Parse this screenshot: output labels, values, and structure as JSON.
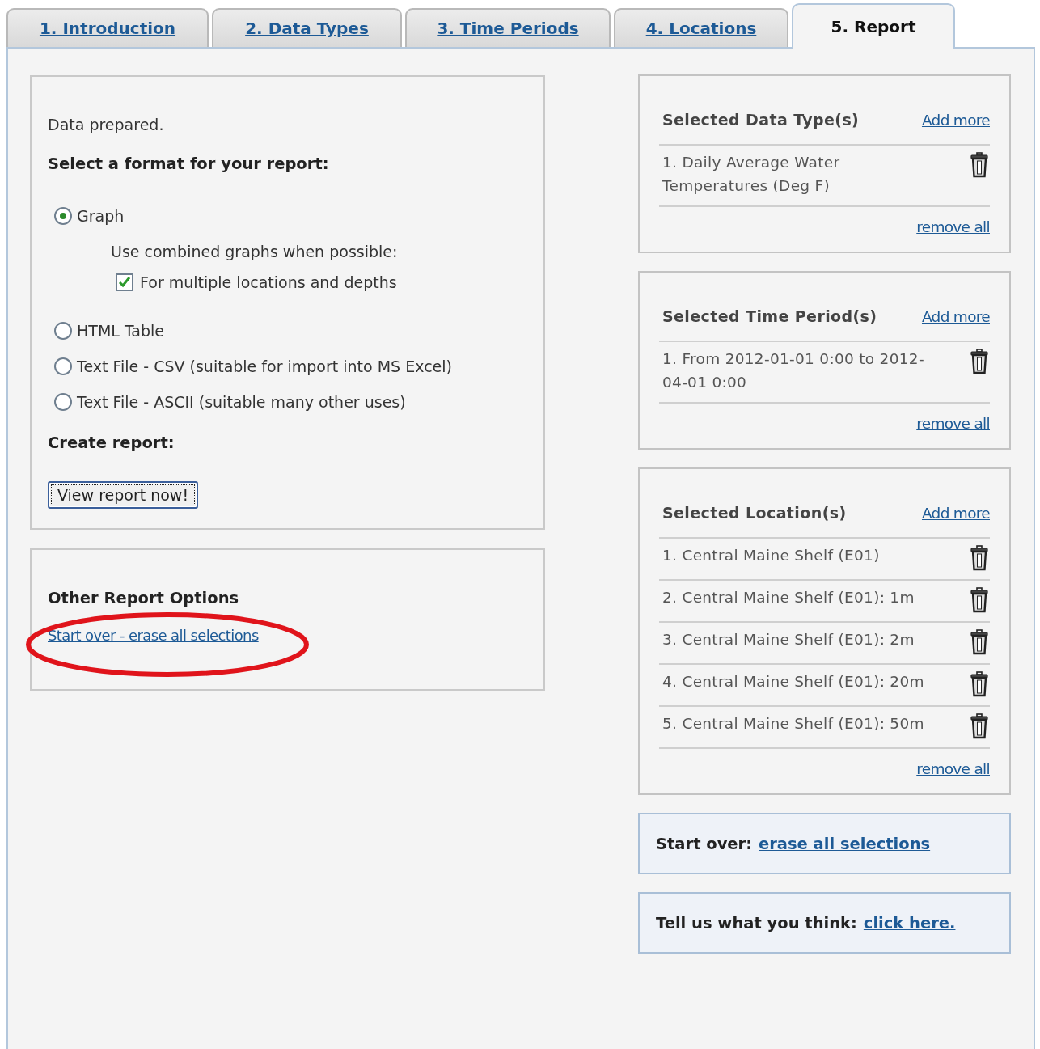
{
  "tabs": [
    {
      "label": "1. Introduction",
      "selected": false
    },
    {
      "label": "2. Data Types",
      "selected": false
    },
    {
      "label": "3. Time Periods",
      "selected": false
    },
    {
      "label": "4. Locations",
      "selected": false
    },
    {
      "label": "5. Report",
      "selected": true
    }
  ],
  "report_panel": {
    "status": "Data prepared.",
    "format_heading": "Select a format for your report:",
    "formats": [
      {
        "label": "Graph",
        "selected": true,
        "sub": {
          "label": "Use combined graphs when possible:",
          "option": {
            "label": "For multiple locations and depths",
            "checked": true
          }
        }
      },
      {
        "label": "HTML Table",
        "selected": false
      },
      {
        "label": "Text File - CSV (suitable for import into MS Excel)",
        "selected": false
      },
      {
        "label": "Text File - ASCII (suitable many other uses)",
        "selected": false
      }
    ],
    "create_heading": "Create report:",
    "button": "View report now!"
  },
  "other_options": {
    "heading": "Other Report Options",
    "link": "Start over - erase all selections",
    "highlight": {
      "kind": "ellipse"
    }
  },
  "selections": [
    {
      "title": "Selected Data Type(s)",
      "add_link": "Add more",
      "items": [
        "1. Daily Average Water Temperatures (Deg F)"
      ],
      "remove_link": "remove all"
    },
    {
      "title": "Selected Time Period(s)",
      "add_link": "Add more",
      "items": [
        "1. From 2012-01-01 0:00 to 2012-04-01 0:00"
      ],
      "remove_link": "remove all"
    },
    {
      "title": "Selected Location(s)",
      "add_link": "Add more",
      "items": [
        "1. Central Maine Shelf (E01)",
        "2. Central Maine Shelf (E01): 1m",
        "3. Central Maine Shelf (E01): 2m",
        "4. Central Maine Shelf (E01): 20m",
        "5. Central Maine Shelf (E01): 50m"
      ],
      "remove_link": "remove all"
    }
  ],
  "start_over": {
    "label": "Start over:",
    "link": "erase all selections"
  },
  "feedback": {
    "label": "Tell us what you think:",
    "link": "click here."
  }
}
